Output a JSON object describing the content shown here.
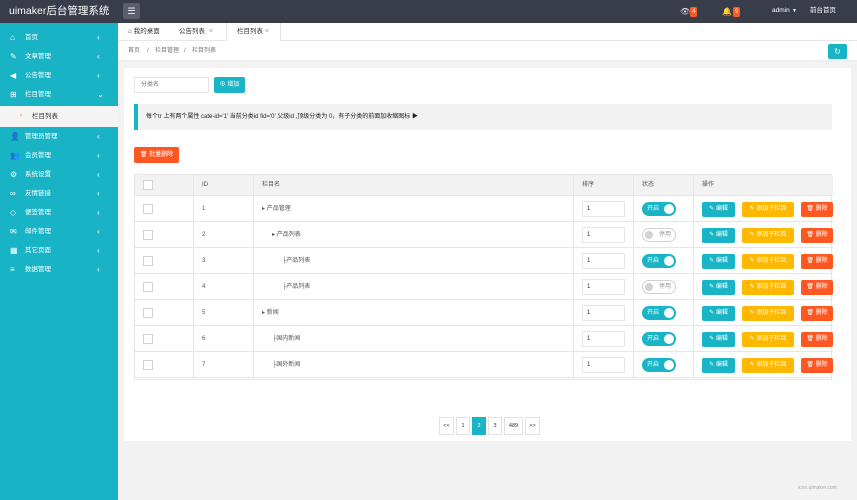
{
  "header": {
    "brand": "uimaker后台管理系统",
    "menu_icon": "menu-icon",
    "eye_badge": "4",
    "bell_badge": "9",
    "user": "admin",
    "front_link": "前台首页"
  },
  "sidebar": {
    "items": [
      {
        "label": "首页",
        "icon": "home-icon"
      },
      {
        "label": "文章管理",
        "icon": "edit-icon"
      },
      {
        "label": "公告管理",
        "icon": "megaphone-icon"
      },
      {
        "label": "栏目管理",
        "icon": "sitemap-icon"
      },
      {
        "label": "栏目列表",
        "icon": "chevron-right-icon"
      },
      {
        "label": "管理员管理",
        "icon": "user-icon"
      },
      {
        "label": "会员管理",
        "icon": "users-icon"
      },
      {
        "label": "系统设置",
        "icon": "gear-icon"
      },
      {
        "label": "友情链接",
        "icon": "link-icon"
      },
      {
        "label": "便签管理",
        "icon": "tag-icon"
      },
      {
        "label": "邮件管理",
        "icon": "mail-icon"
      },
      {
        "label": "其它页面",
        "icon": "grid-icon"
      },
      {
        "label": "数据管理",
        "icon": "database-icon"
      }
    ]
  },
  "tabs": [
    {
      "label": "我的桌面"
    },
    {
      "label": "公告列表"
    },
    {
      "label": "栏目列表"
    }
  ],
  "breadcrumb": {
    "home": "首页",
    "sep": "/",
    "level1": "栏目管理",
    "level2": "栏目列表"
  },
  "toolbar": {
    "category_placeholder": "分类名",
    "add_label": "增加",
    "tip": "每个tr 上有两个属性 cate-id='1' 当前分类id fid='0' 父级id ,顶级分类为 0，有子分类的前面加收缩图标",
    "batch_delete": "批量删除"
  },
  "table": {
    "headers": [
      "ID",
      "栏目名",
      "排序",
      "状态",
      "操作"
    ],
    "rows": [
      {
        "id": "1",
        "name": "产品管理",
        "prefix": "▸ ",
        "indent": 0,
        "sort": "1",
        "status": "开启",
        "on": true
      },
      {
        "id": "2",
        "name": "产品列表",
        "prefix": "▸ ",
        "indent": 1,
        "sort": "1",
        "status": "停用",
        "on": false
      },
      {
        "id": "3",
        "name": "├产品列表",
        "prefix": "",
        "indent": 2,
        "sort": "1",
        "status": "开启",
        "on": true
      },
      {
        "id": "4",
        "name": "├产品列表",
        "prefix": "",
        "indent": 2,
        "sort": "1",
        "status": "停用",
        "on": false
      },
      {
        "id": "5",
        "name": "新闻",
        "prefix": "▸ ",
        "indent": 0,
        "sort": "1",
        "status": "开启",
        "on": true
      },
      {
        "id": "6",
        "name": "├国内新闻",
        "prefix": "",
        "indent": 1,
        "sort": "1",
        "status": "开启",
        "on": true
      },
      {
        "id": "7",
        "name": "├国外新闻",
        "prefix": "",
        "indent": 1,
        "sort": "1",
        "status": "开启",
        "on": true
      }
    ],
    "actions": {
      "edit": "编辑",
      "add_sub": "添加子栏目",
      "delete": "删除"
    }
  },
  "pagination": {
    "prev": "<<",
    "pages": [
      "1",
      "2",
      "3",
      "489"
    ],
    "current": "2",
    "next": ">>"
  },
  "footer": "icon.uimaker.com"
}
